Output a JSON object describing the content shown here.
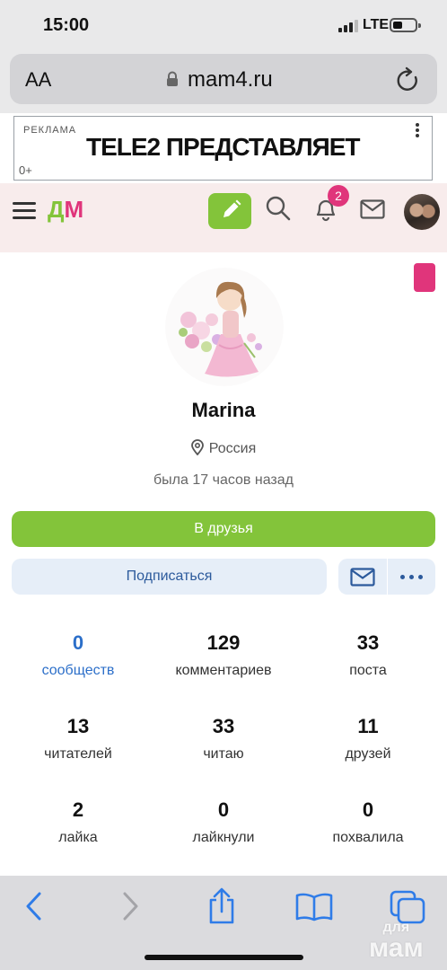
{
  "status_bar": {
    "time": "15:00",
    "network": "LTE"
  },
  "browser": {
    "text_size_label": "AA",
    "url": "mam4.ru"
  },
  "ad": {
    "label": "РЕКЛАМА",
    "age": "0+",
    "text": "TELE2 ПРЕДСТАВЛЯЕТ"
  },
  "site_header": {
    "logo_d": "Д",
    "logo_m": "М",
    "notifications_count": "2"
  },
  "profile": {
    "name": "Marina",
    "location": "Россия",
    "last_seen": "была 17 часов назад",
    "add_friend_label": "В друзья",
    "subscribe_label": "Подписаться"
  },
  "stats": [
    {
      "value": "0",
      "label": "сообществ"
    },
    {
      "value": "129",
      "label": "комментариев"
    },
    {
      "value": "33",
      "label": "поста"
    },
    {
      "value": "13",
      "label": "читателей"
    },
    {
      "value": "33",
      "label": "читаю"
    },
    {
      "value": "11",
      "label": "друзей"
    },
    {
      "value": "2",
      "label": "лайка"
    },
    {
      "value": "0",
      "label": "лайкнули"
    },
    {
      "value": "0",
      "label": "похвалила"
    }
  ],
  "watermark": {
    "line1": "для",
    "line2": "мам"
  },
  "colors": {
    "accent_green": "#83c43a",
    "accent_pink": "#e0357b",
    "link_blue": "#2c6fc9",
    "button_blue_bg": "#e6eef8"
  }
}
